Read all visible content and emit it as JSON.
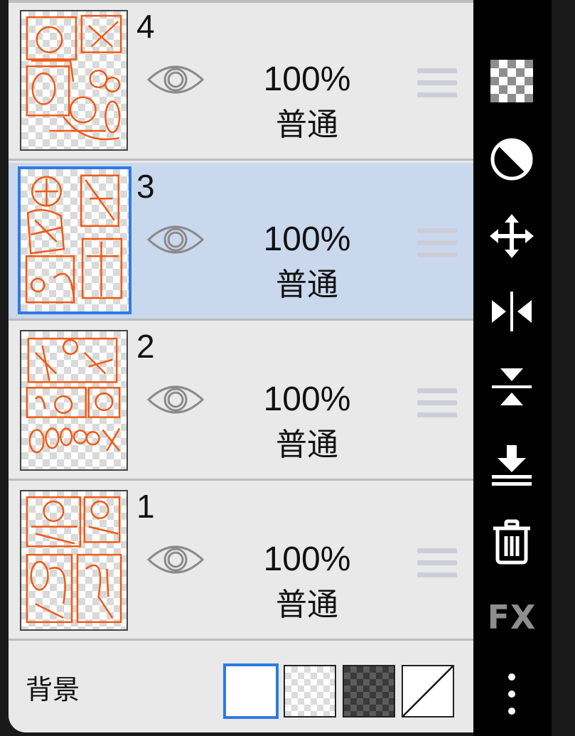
{
  "layers": [
    {
      "number": "4",
      "opacity": "100%",
      "blend": "普通",
      "selected": false
    },
    {
      "number": "3",
      "opacity": "100%",
      "blend": "普通",
      "selected": true
    },
    {
      "number": "2",
      "opacity": "100%",
      "blend": "普通",
      "selected": false
    },
    {
      "number": "1",
      "opacity": "100%",
      "blend": "普通",
      "selected": false
    }
  ],
  "background": {
    "label": "背景",
    "options": [
      "white",
      "light-checker",
      "dark-checker",
      "none"
    ],
    "selected": "white"
  },
  "toolbar": {
    "icons": [
      "checker-icon",
      "contrast-icon",
      "move-icon",
      "flip-horizontal-icon",
      "flip-vertical-icon",
      "merge-down-icon",
      "trash-icon",
      "fx-icon",
      "more-icon"
    ],
    "fx_label": "FX"
  },
  "colors": {
    "selection": "#2f7ae5",
    "selected_row": "#cad8ee",
    "sketch": "#f05a14"
  }
}
